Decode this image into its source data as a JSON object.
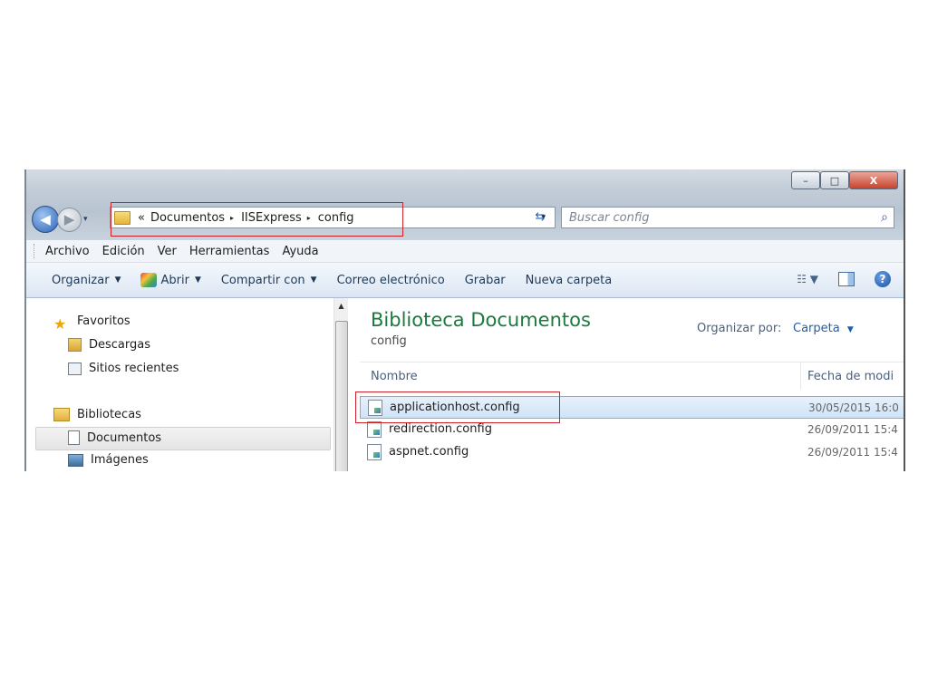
{
  "window": {
    "caption_buttons": {
      "minimize": "–",
      "maximize": "□",
      "close": "X"
    }
  },
  "nav": {
    "back_icon": "back-arrow-icon",
    "forward_icon": "forward-arrow-icon",
    "dropdown": "▾"
  },
  "address": {
    "overflow": "«",
    "crumbs": [
      "Documentos",
      "IISExpress",
      "config"
    ],
    "separator": "▸",
    "dropdown": "▾"
  },
  "search": {
    "placeholder": "Buscar config",
    "icon": "search-icon"
  },
  "menu": [
    "Archivo",
    "Edición",
    "Ver",
    "Herramientas",
    "Ayuda"
  ],
  "commands": {
    "organize": "Organizar",
    "open": "Abrir",
    "share": "Compartir con",
    "email": "Correo electrónico",
    "burn": "Grabar",
    "new_folder": "Nueva carpeta"
  },
  "sidebar": {
    "favorites": "Favoritos",
    "downloads": "Descargas",
    "recent": "Sitios recientes",
    "libraries": "Bibliotecas",
    "documents": "Documentos",
    "images": "Imágenes"
  },
  "library": {
    "title": "Biblioteca Documentos",
    "subtitle": "config",
    "arrange_label": "Organizar por:",
    "arrange_value": "Carpeta"
  },
  "columns": {
    "name": "Nombre",
    "date": "Fecha de modi"
  },
  "files": [
    {
      "name": "applicationhost.config",
      "date": "30/05/2015 16:0",
      "selected": true
    },
    {
      "name": "redirection.config",
      "date": "26/09/2011 15:4",
      "selected": false
    },
    {
      "name": "aspnet.config",
      "date": "26/09/2011 15:4",
      "selected": false
    }
  ],
  "colors": {
    "highlight_box": "#cc2127",
    "library_title": "#1b7a3e",
    "link": "#1f5fa8"
  }
}
